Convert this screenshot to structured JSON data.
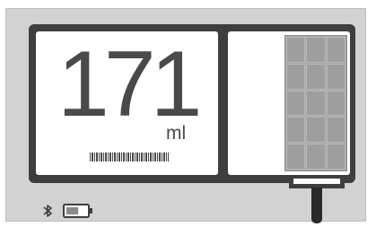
{
  "device": {
    "volume_value": "171",
    "volume_unit": "ml"
  },
  "status_bar": {
    "bluetooth_icon": "bluetooth-icon",
    "battery_icon": "battery-icon",
    "battery_level": 0.6
  },
  "gauge": {
    "rows": 5,
    "columns": 3
  },
  "colors": {
    "panel": "#3e3e3e",
    "background": "#d2d2d2",
    "text": "#4a4a4a"
  }
}
